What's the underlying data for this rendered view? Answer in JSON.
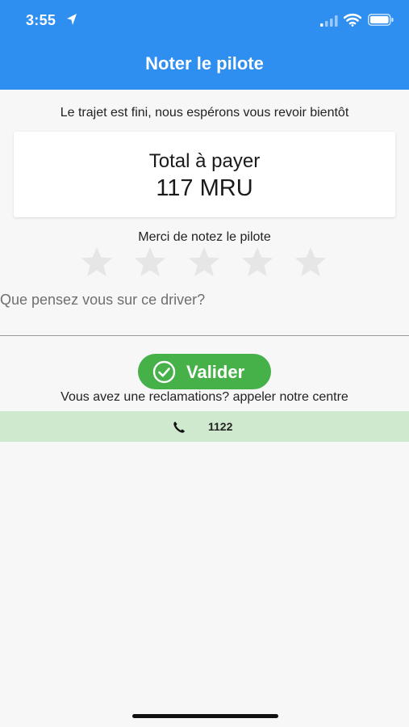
{
  "status_bar": {
    "time": "3:55",
    "icons": [
      "location-arrow-icon",
      "signal-icon",
      "wifi-icon",
      "battery-icon"
    ]
  },
  "header": {
    "title": "Noter le pilote",
    "background_color": "#2f8ff0"
  },
  "main": {
    "subtitle": "Le trajet est fini, nous espérons vous revoir bientôt",
    "total_label": "Total à payer",
    "total_amount": "117 MRU",
    "rate_prompt": "Merci de notez le pilote",
    "rating": {
      "max_stars": 5,
      "selected": 0,
      "star_icon": "star-icon",
      "empty_color": "#e6e6e6"
    },
    "comment": {
      "placeholder": "Que pensez vous sur ce driver?",
      "value": ""
    },
    "validate_button": {
      "label": "Valider",
      "icon": "check-circle-icon",
      "color": "#46b049"
    },
    "claim_text": "Vous avez une reclamations? appeler notre centre",
    "phone": {
      "icon": "phone-icon",
      "number": "1122",
      "background_color": "#cfe9cf"
    }
  }
}
